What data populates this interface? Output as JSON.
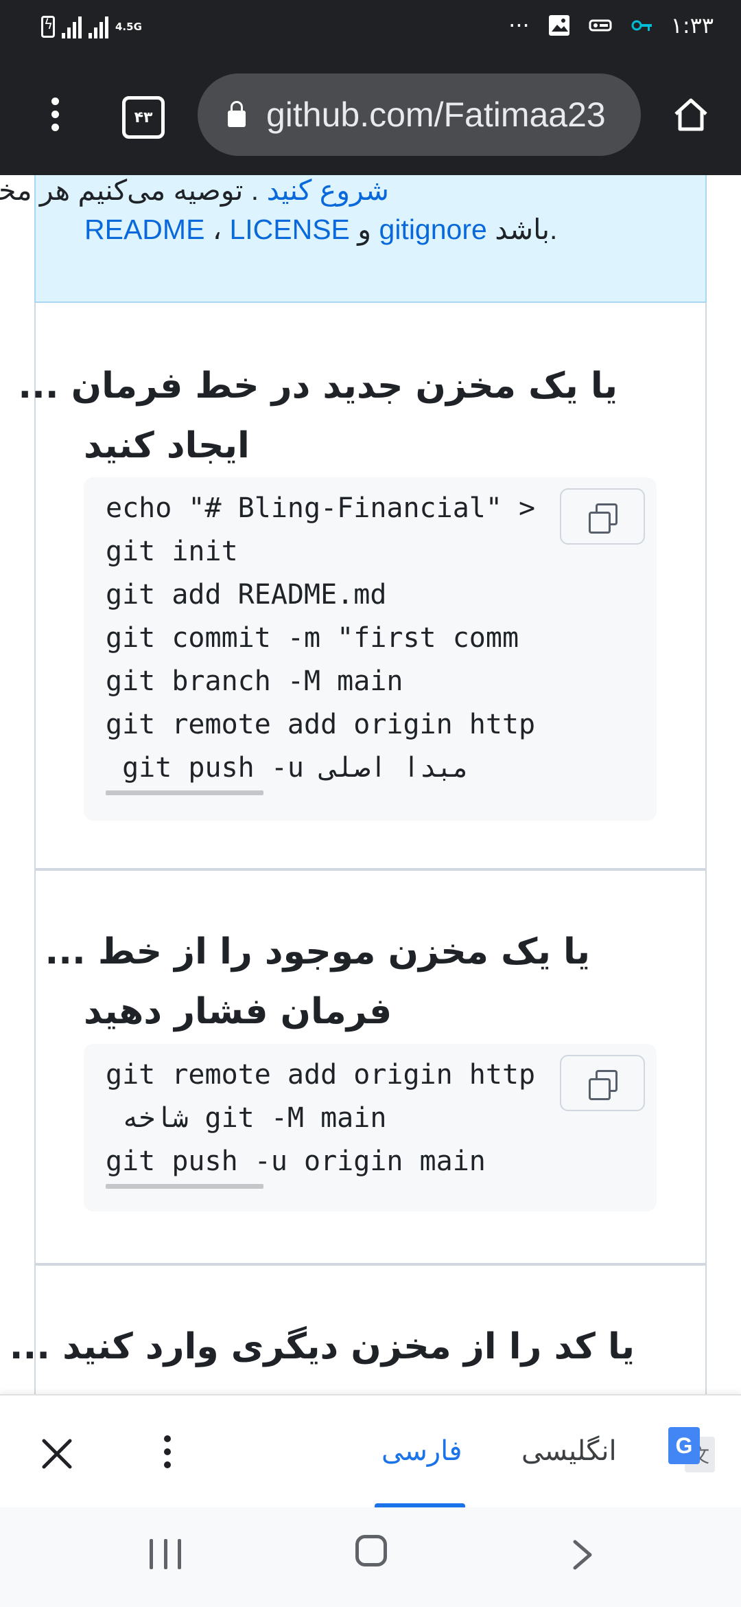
{
  "status_bar": {
    "network": "4.5G",
    "dots": "···",
    "time": "۱:۳۳",
    "icons": [
      "battery-charging-icon",
      "signal-icon",
      "signal-icon",
      "more-dots-icon",
      "image-icon",
      "vpn-key-icon",
      "key-icon"
    ]
  },
  "browser": {
    "tab_count": "۴۳",
    "url": "github.com/Fatimaa23",
    "icons": [
      "menu-kebab-icon",
      "tabs-icon",
      "lock-icon",
      "home-icon"
    ]
  },
  "banner": {
    "line1_link": "شروع کنید",
    "line1_text": " . توصیه می‌کنیم هر مخزن شامل",
    "readme": "README",
    "sep1": " ، ",
    "license": "LICENSE",
    "sep2": " و ",
    "gitignore": "gitignore",
    "tail": " باشد."
  },
  "section_create": {
    "heading_line1": "یا یک مخزن جدید در خط فرمان ...",
    "heading_line2": "ایجاد کنید",
    "code_lines": [
      "echo \"# Bling-Financial\" >",
      "git init",
      "git add README.md",
      "git commit -m \"first comm",
      "git branch -M main",
      "git remote add origin http",
      " git push -u مبدا اصلی"
    ]
  },
  "section_push": {
    "heading_line1": "یا یک مخزن موجود را از خط ...",
    "heading_line2": "فرمان فشار دهید",
    "code_lines": [
      "git remote add origin http",
      " شاخه git -M main",
      "git push -u origin main"
    ]
  },
  "section_import": {
    "heading_line1": "یا کد را از مخزن دیگری وارد کنید ..."
  },
  "translate_bar": {
    "target_language": "فارسی",
    "source_language": "انگلیسی",
    "logo_letter_g": "G",
    "logo_letter_t": "文"
  },
  "colors": {
    "toolbar_bg": "#202124",
    "link": "#0969da",
    "banner_bg": "#ddf4ff",
    "code_bg": "#f6f8fa",
    "translate_accent": "#1a73e8"
  }
}
